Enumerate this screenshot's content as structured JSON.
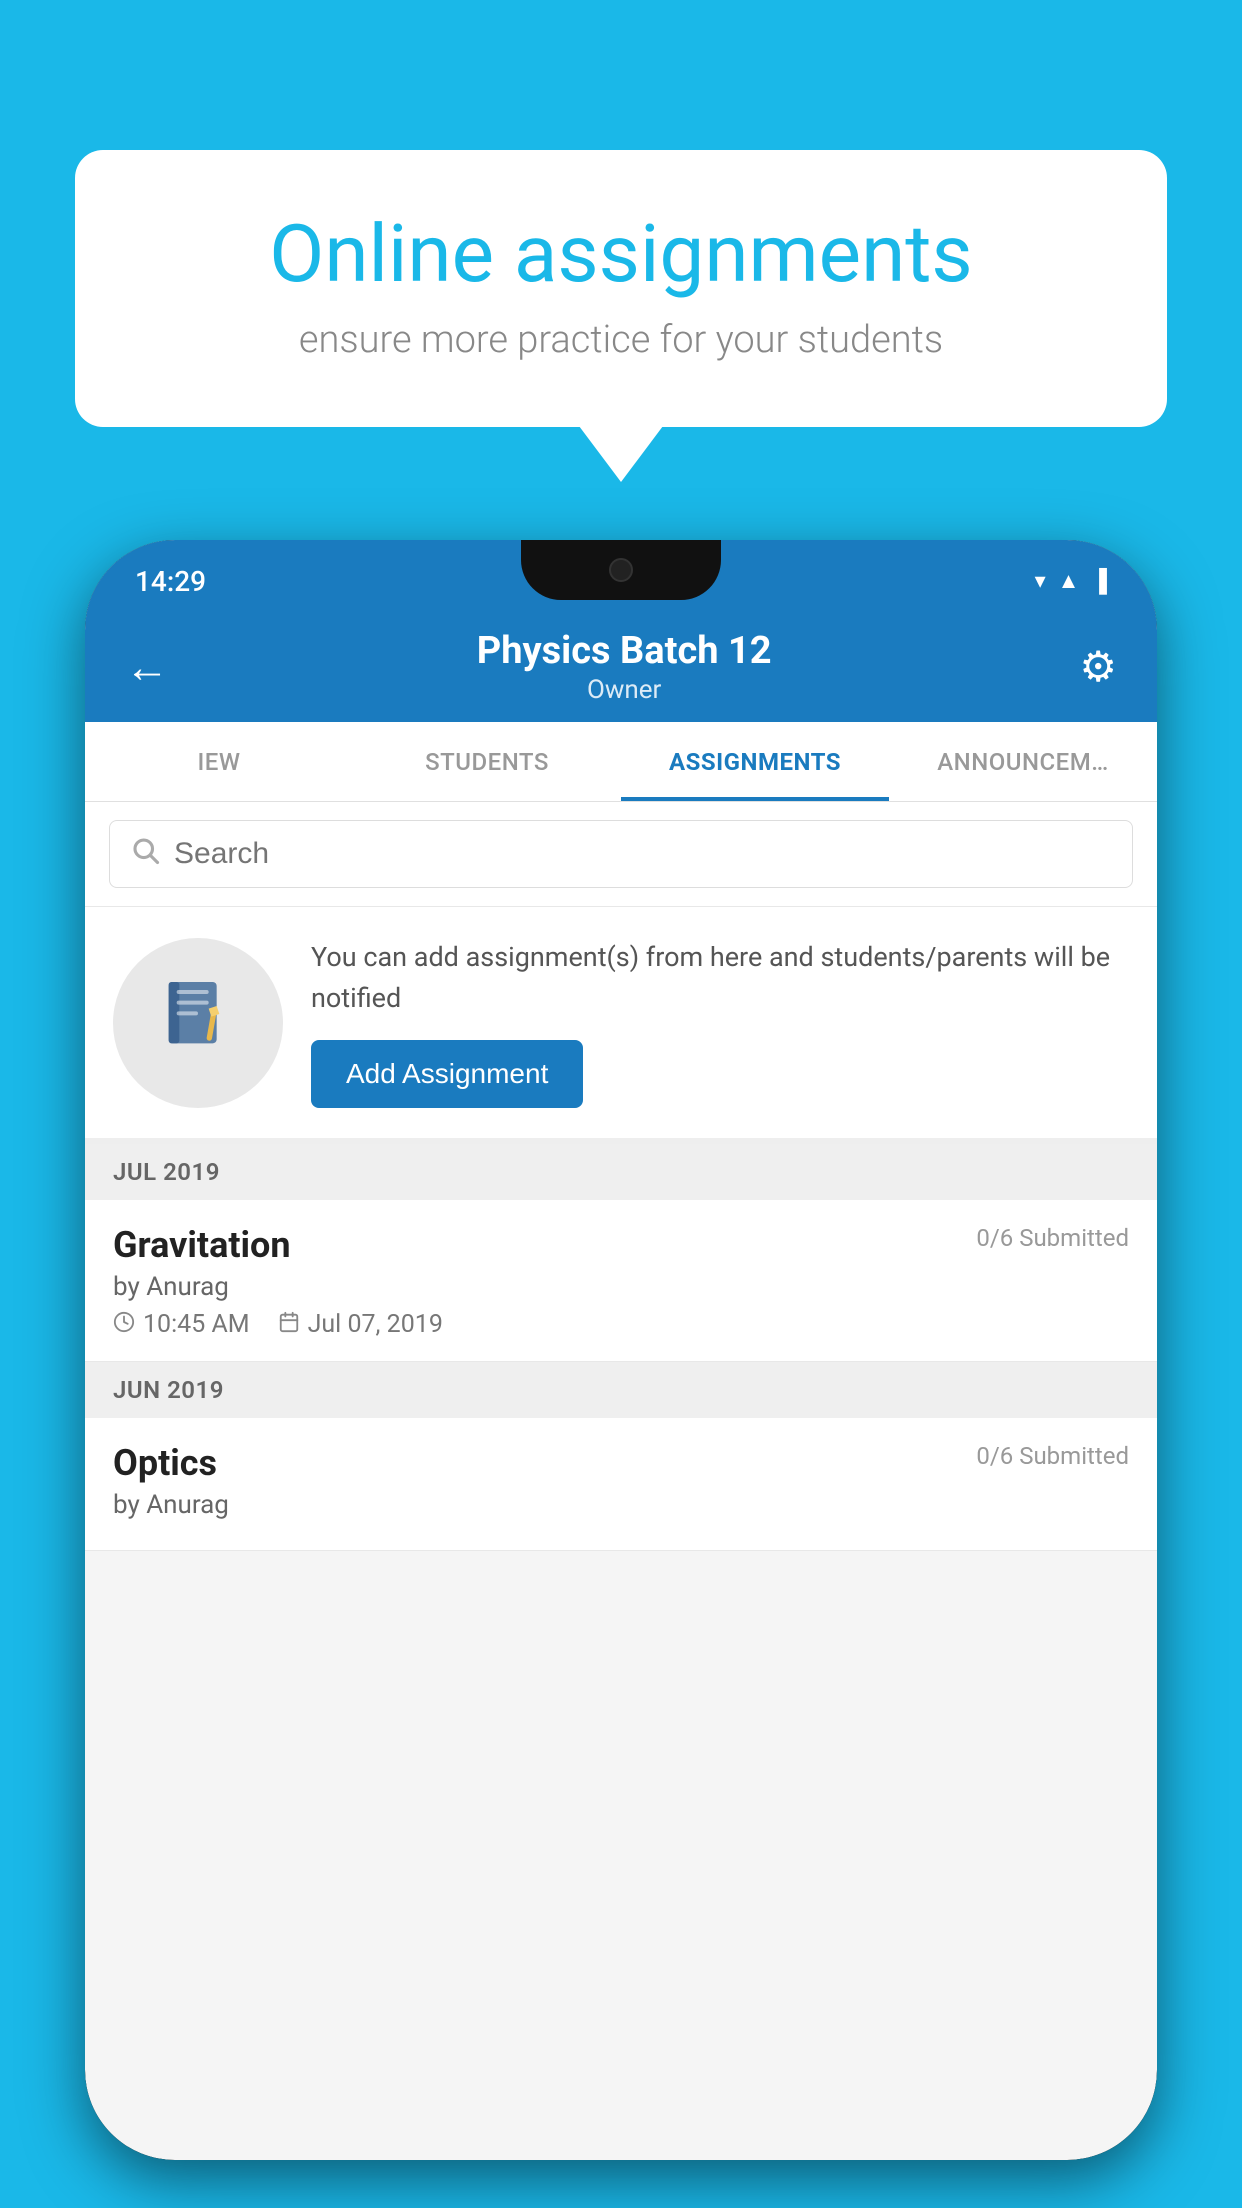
{
  "background_color": "#1ab8e8",
  "speech_bubble": {
    "title": "Online assignments",
    "subtitle": "ensure more practice for your students"
  },
  "status_bar": {
    "time": "14:29",
    "icons": [
      "wifi",
      "signal",
      "battery"
    ]
  },
  "header": {
    "title": "Physics Batch 12",
    "subtitle": "Owner",
    "back_label": "←",
    "settings_label": "⚙"
  },
  "tabs": [
    {
      "label": "IEW",
      "active": false
    },
    {
      "label": "STUDENTS",
      "active": false
    },
    {
      "label": "ASSIGNMENTS",
      "active": true
    },
    {
      "label": "ANNOUNCEM…",
      "active": false
    }
  ],
  "search": {
    "placeholder": "Search"
  },
  "promo": {
    "text": "You can add assignment(s) from here and students/parents will be notified",
    "button_label": "Add Assignment"
  },
  "sections": [
    {
      "header": "JUL 2019",
      "assignments": [
        {
          "title": "Gravitation",
          "submitted": "0/6 Submitted",
          "author": "by Anurag",
          "time": "10:45 AM",
          "date": "Jul 07, 2019"
        }
      ]
    },
    {
      "header": "JUN 2019",
      "assignments": [
        {
          "title": "Optics",
          "submitted": "0/6 Submitted",
          "author": "by Anurag",
          "time": "",
          "date": ""
        }
      ]
    }
  ]
}
